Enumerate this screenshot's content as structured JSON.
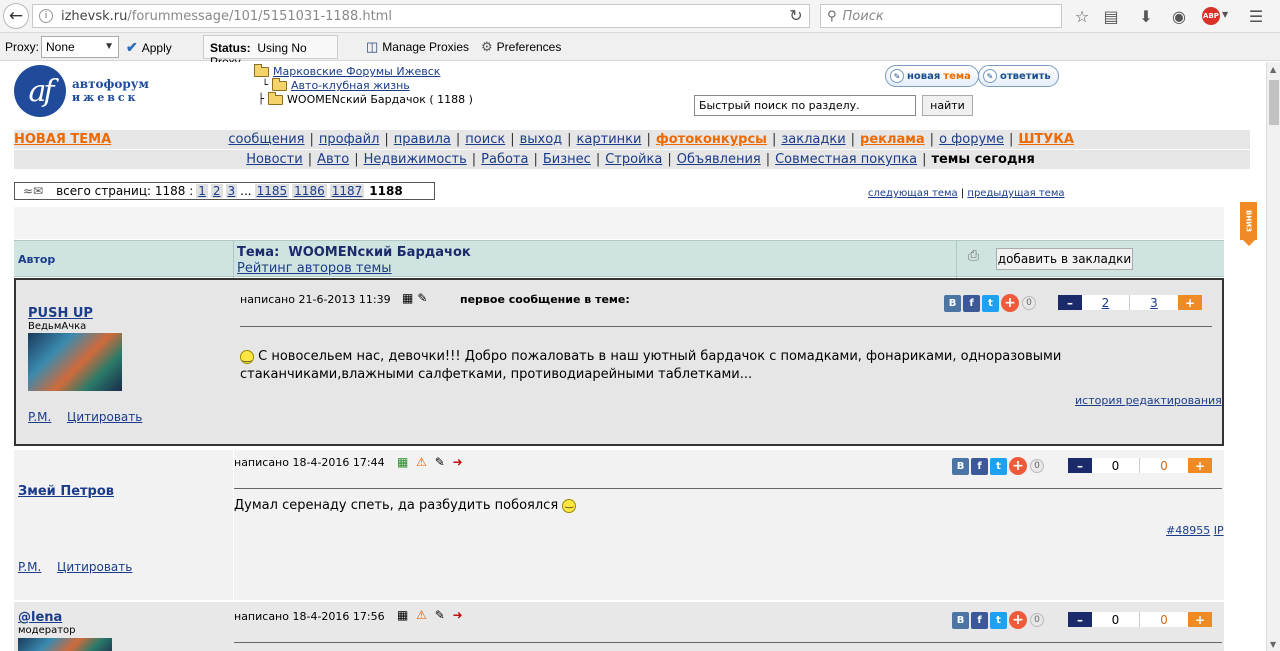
{
  "browser": {
    "url_main": "izhevsk.ru",
    "url_rest": "/forummessage/101/5151031-1188.html",
    "search_placeholder": "Поиск",
    "back_icon": "back-arrow-icon",
    "info_icon": "info-icon",
    "reload_icon": "reload-icon",
    "abp_label": "ABP"
  },
  "proxy": {
    "label": "Proxy:",
    "selected": "None",
    "apply": "Apply",
    "status_label": "Status:",
    "status_value": "Using No Proxy",
    "manage": "Manage Proxies",
    "prefs": "Preferences"
  },
  "site": {
    "logo_letters": "af",
    "logo_line1": "автофорум",
    "logo_line2": "ижевск",
    "crumbs": [
      "Марковские Форумы Ижевск",
      "Авто-клубная жизнь",
      "WOOMENский Бардачок ( 1188 )"
    ],
    "btn_new_topic_a": "новая",
    "btn_new_topic_b": "тема",
    "btn_reply": "ответить",
    "quick_search_value": "Быстрый поиск по разделу.",
    "quick_search_btn": "найти"
  },
  "menu1": {
    "new_topic": "НОВАЯ ТЕМА",
    "items": [
      "сообщения",
      "профайл",
      "правила",
      "поиск",
      "выход",
      "картинки",
      "фотоконкурсы",
      "закладки",
      "реклама",
      "о форуме",
      "ШТУКА"
    ]
  },
  "menu2": {
    "items": [
      "Новости",
      "Авто",
      "Недвижимость",
      "Работа",
      "Бизнес",
      "Стройка",
      "Объявления",
      "Совместная покупка",
      "темы сегодня"
    ]
  },
  "pager": {
    "total_label": "всего страниц: 1188 :",
    "pages": [
      "1",
      "2",
      "3",
      "...",
      "1185",
      "1186",
      "1187",
      "1188"
    ]
  },
  "topic_nav": {
    "next": "следующая тема",
    "prev": "предыдущая тема",
    "vniz": "ВНИЗ"
  },
  "thread_head": {
    "author_col": "Автор",
    "topic_prefix": "Тема:",
    "topic_title": "WOOMENский Бардачок",
    "rating_link": "Рейтинг авторов темы",
    "bookmark_btn": "добавить в закладки",
    "printer_icon": "printer-icon"
  },
  "posts": [
    {
      "author": "PUSH UP",
      "subtitle": "ВедьмАчка",
      "date": "написано 21-6-2013 11:39",
      "first_label": "первое сообщение в теме:",
      "text": "С новосельем нас, девочки!!! Добро пожаловать в наш уютный бардачок с помадками, фонариками, одноразовыми стаканчиками,влажными салфетками, противодиарейными таблетками...",
      "edit_history": "история редактирования",
      "pm": "P.M.",
      "quote": "Цитировать",
      "share_count": "0",
      "vote_minus": "2",
      "vote_plus": "3"
    },
    {
      "author": "Змей Петров",
      "subtitle": "",
      "date": "написано 18-4-2016 17:44",
      "text": "Думал серенаду спеть, да разбудить побоялся",
      "msg_id": "#48955",
      "ip": "IP",
      "pm": "P.M.",
      "quote": "Цитировать",
      "share_count": "0",
      "vote_minus": "0",
      "vote_plus": "0"
    },
    {
      "author": "@lena",
      "subtitle": "модератор",
      "date": "написано 18-4-2016 17:56",
      "share_count": "0",
      "vote_minus": "0",
      "vote_plus": "0"
    }
  ],
  "share": {
    "vk": "В",
    "fb": "f",
    "tw": "t",
    "vk_color": "#4c75a3",
    "fb_color": "#3b5998",
    "tw_color": "#1da1f2"
  }
}
